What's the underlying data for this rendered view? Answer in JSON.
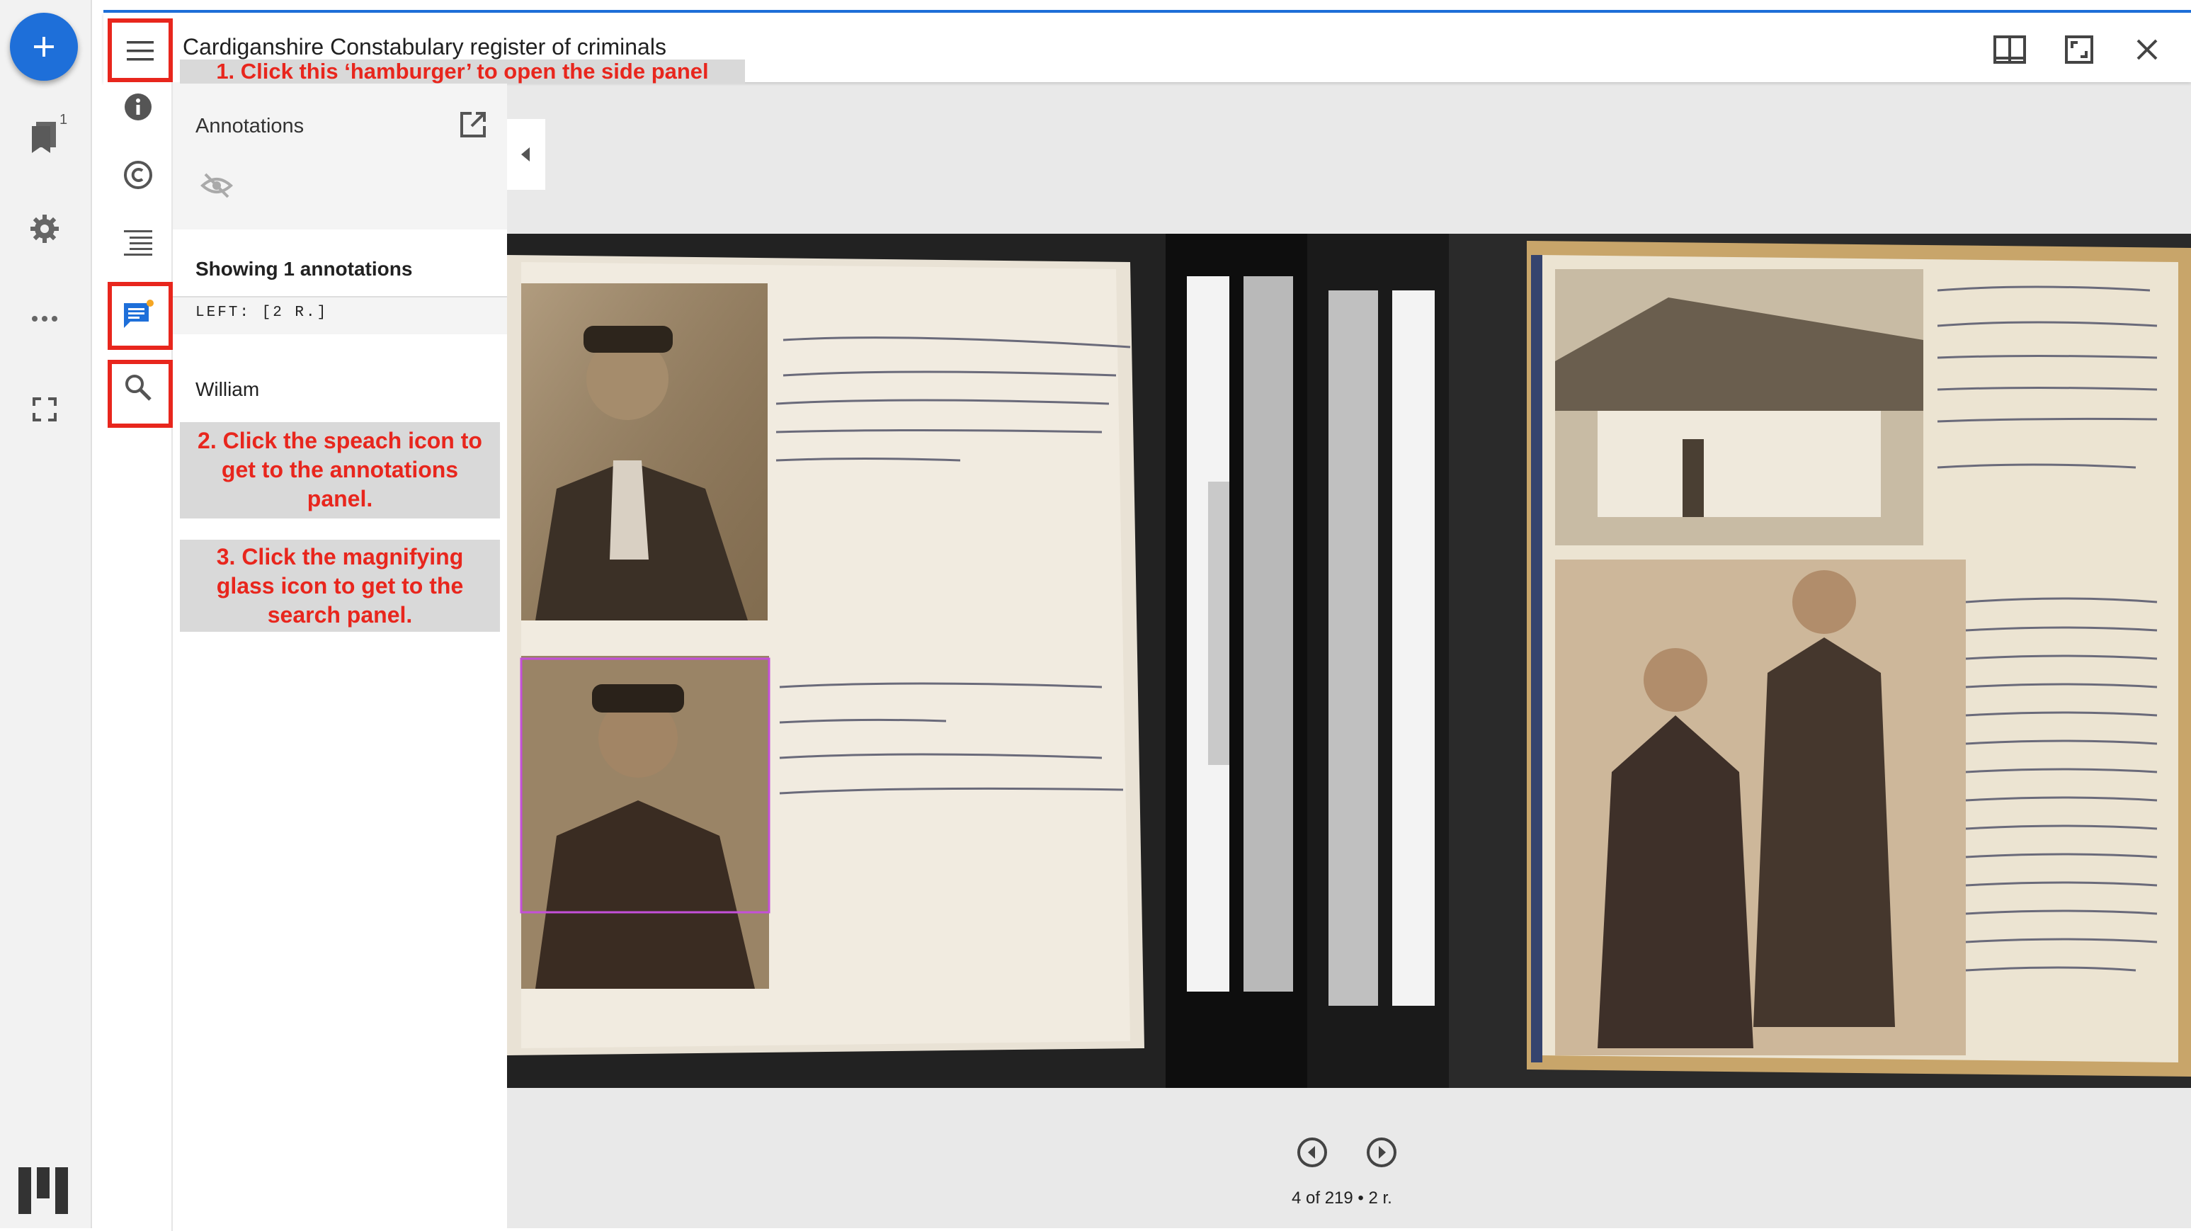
{
  "app_rail": {
    "add_icon": "plus-icon",
    "bookmark_count": "1",
    "icons": [
      "plus-icon",
      "bookmark-icon",
      "gear-icon",
      "more-horiz-icon",
      "fullscreen-icon",
      "mirador-logo"
    ]
  },
  "window": {
    "title": "Cardiganshire Constabulary register of criminals",
    "accent_color": "#1e6fd9",
    "toolbar_icons": [
      "view-layout-icon",
      "maximize-icon",
      "close-icon"
    ]
  },
  "side_strip": {
    "icons": [
      "menu-icon",
      "info-icon",
      "copyright-icon",
      "toc-icon",
      "annotations-icon",
      "search-icon"
    ]
  },
  "panel": {
    "title": "Annotations",
    "showing": "Showing 1 annotations",
    "canvas_label": "LEFT: [2 R.]",
    "annotation_text": "William"
  },
  "instructions": {
    "step1": "1. Click this ‘hamburger’ to open the side panel",
    "step2_lines": [
      "2. Click the speach icon to",
      "get to the annotations",
      "panel."
    ],
    "step3_lines": [
      "3. Click the magnifying",
      "glass icon to get to the",
      "search panel."
    ],
    "highlight_color": "#e8261d"
  },
  "viewer": {
    "page_indicator": "4 of 219 • 2 r.",
    "nav_icons": [
      "previous-icon",
      "next-icon"
    ]
  }
}
